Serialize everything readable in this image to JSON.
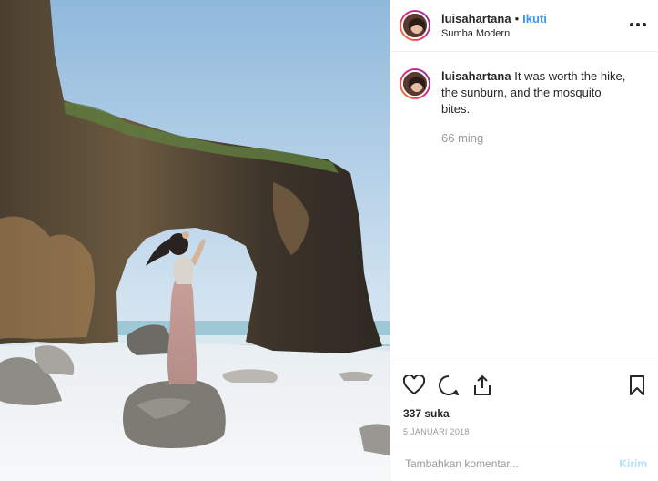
{
  "post": {
    "header": {
      "username": "luisahartana",
      "separator": "•",
      "follow_label": "Ikuti",
      "location": "Sumba Modern",
      "more_icon": "more-horizontal-icon"
    },
    "caption": {
      "username": "luisahartana",
      "text": "It was worth the hike, the sunburn, and the mosquito bites.",
      "time": "66 ming"
    },
    "actions": {
      "icons": [
        "heart-icon",
        "comment-icon",
        "share-icon",
        "bookmark-icon"
      ]
    },
    "likes": "337 suka",
    "date": "5 JANUARI 2018",
    "comment_box": {
      "placeholder": "Tambahkan komentar...",
      "send_label": "Kirim"
    },
    "colors": {
      "link": "#3897f0",
      "send_disabled": "#b2dffc",
      "muted": "#999999",
      "text": "#262626"
    }
  }
}
